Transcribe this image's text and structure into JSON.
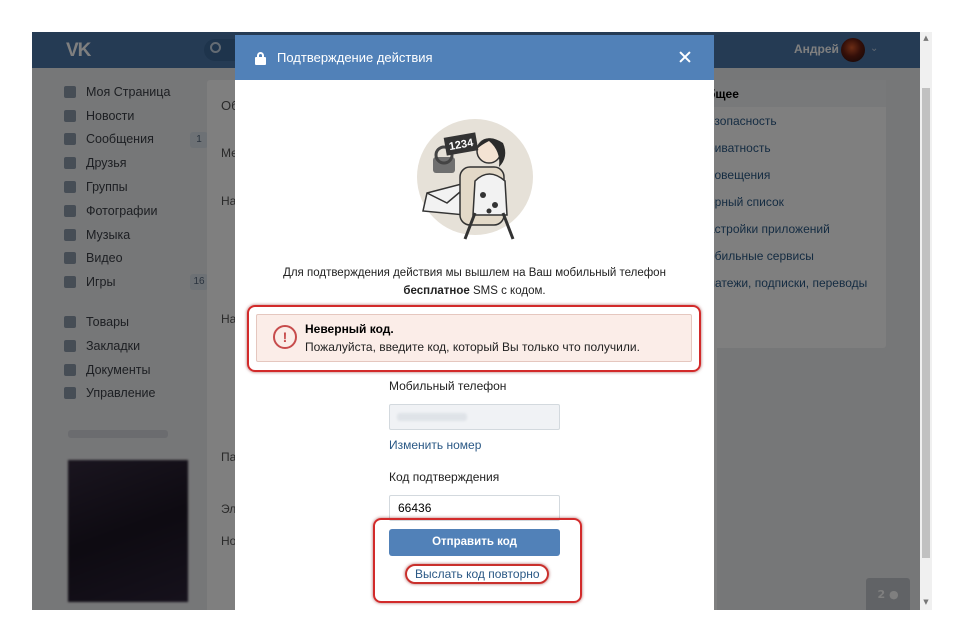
{
  "header": {
    "logo": "VK",
    "user_name": "Андрей"
  },
  "sidebar": {
    "items": [
      {
        "label": "Моя Страница",
        "badge": ""
      },
      {
        "label": "Новости",
        "badge": ""
      },
      {
        "label": "Сообщения",
        "badge": "1"
      },
      {
        "label": "Друзья",
        "badge": ""
      },
      {
        "label": "Группы",
        "badge": ""
      },
      {
        "label": "Фотографии",
        "badge": ""
      },
      {
        "label": "Музыка",
        "badge": ""
      },
      {
        "label": "Видео",
        "badge": ""
      },
      {
        "label": "Игры",
        "badge": "16"
      }
    ],
    "items2": [
      {
        "label": "Товары"
      },
      {
        "label": "Закладки"
      },
      {
        "label": "Документы"
      },
      {
        "label": "Управление"
      }
    ]
  },
  "settings_menu": {
    "items": [
      {
        "label": "бщее"
      },
      {
        "label": "езопасность"
      },
      {
        "label": "риватность"
      },
      {
        "label": "повещения"
      },
      {
        "label": "ёрный список"
      },
      {
        "label": "астройки приложений"
      },
      {
        "label": "обильные сервисы"
      },
      {
        "label": "латежи, подписки, переводы"
      }
    ]
  },
  "content_fragments": [
    "Об",
    "Ме",
    "На",
    "На",
    "Па",
    "Эл",
    "Но"
  ],
  "chat_count": "2",
  "modal": {
    "title": "Подтверждение действия",
    "description_line1": "Для подтверждения действия мы вышлем на Ваш мобильный телефон",
    "description_bold": "бесплатное",
    "description_rest": " SMS с кодом.",
    "illustration_number": "1234",
    "error": {
      "title": "Неверный код.",
      "text": "Пожалуйста, введите код, который Вы только что получили."
    },
    "phone_label": "Мобильный телефон",
    "change_number": "Изменить номер",
    "code_label": "Код подтверждения",
    "code_value": "66436",
    "send_button": "Отправить код",
    "resend_link": "Выслать код повторно"
  },
  "colors": {
    "header": "#4a76a8",
    "modal_header": "#5181b8",
    "link": "#2a5885",
    "error_bg": "#fbede8",
    "highlight": "#d22a2a"
  }
}
